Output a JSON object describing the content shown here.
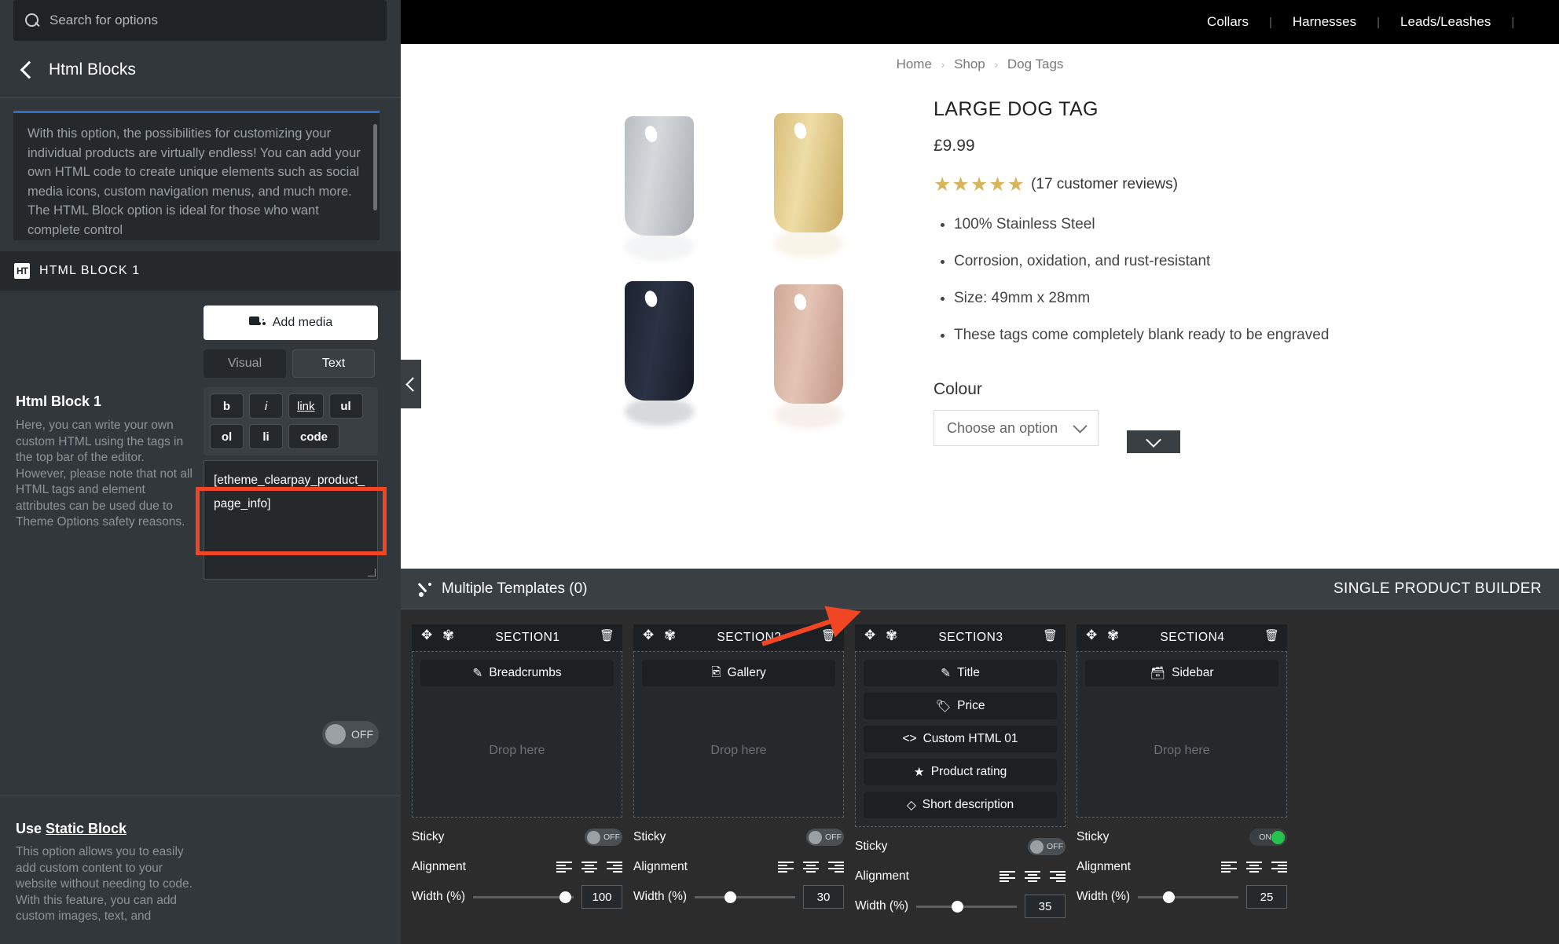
{
  "left_panel": {
    "search": {
      "placeholder": "Search for options",
      "icon": "search-icon"
    },
    "back_icon": "chevron-left-icon",
    "title": "Html Blocks",
    "info_text": "With this option, the possibilities for customizing your individual products are virtually endless! You can add your own HTML code to create unique elements such as social media icons, custom navigation menus, and much more. The HTML Block option is ideal for those who want complete control",
    "block_header": {
      "icon": "html-block-icon",
      "label": "HTML BLOCK 1"
    },
    "field": {
      "title": "Html Block 1",
      "description": "Here, you can write your own custom HTML using the tags in the top bar of the editor. However, please note that not all HTML tags and element attributes can be used due to Theme Options safety reasons."
    },
    "editor": {
      "add_media_label": "Add media",
      "add_media_icon": "media-icon",
      "tabs": [
        "Visual",
        "Text"
      ],
      "active_tab": "Text",
      "quicktags": [
        "b",
        "i",
        "link",
        "ul",
        "ol",
        "li",
        "code"
      ],
      "code_value": "[etheme_clearpay_product_page_info]",
      "highlight_color": "#f04623"
    },
    "static_block": {
      "title_prefix": "Use ",
      "title_link": "Static Block",
      "description": "This option allows you to easily add custom content to your website without needing to code. With this feature, you can add custom images, text, and"
    },
    "bottom_toggle": {
      "state": "OFF"
    }
  },
  "preview": {
    "nav_items": [
      "Collars",
      "Harnesses",
      "Leads/Leashes"
    ],
    "breadcrumb": [
      "Home",
      "Shop",
      "Dog Tags"
    ],
    "product": {
      "title": "LARGE DOG TAG",
      "price": "£9.99",
      "stars": "★★★★★",
      "reviews": "(17 customer reviews)",
      "features": [
        "100% Stainless Steel",
        "Corrosion, oxidation, and rust-resistant",
        "Size: 49mm x 28mm",
        "These tags come completely blank ready to be engraved"
      ],
      "attribute_label": "Colour",
      "attribute_placeholder": "Choose an option",
      "select_icon": "chevron-down-icon"
    },
    "collapse_icon": "chevron-left-icon",
    "scroll_icon": "chevron-down-icon"
  },
  "builder": {
    "templates_label": "Multiple Templates (0)",
    "templates_icon": "templates-icon",
    "builder_mode_label": "SINGLE PRODUCT BUILDER",
    "option_labels": {
      "sticky": "Sticky",
      "alignment": "Alignment",
      "width": "Width (%)"
    },
    "icons": {
      "move": "move-icon",
      "gear": "gear-icon",
      "trash": "trash-icon"
    },
    "sections": [
      {
        "name": "SECTION1",
        "elements": [
          {
            "label": "Breadcrumbs",
            "icon": "breadcrumbs-icon"
          }
        ],
        "drop_placeholder": "Drop here",
        "sticky": "OFF",
        "width": "100"
      },
      {
        "name": "SECTION2",
        "elements": [
          {
            "label": "Gallery",
            "icon": "gallery-icon"
          }
        ],
        "drop_placeholder": "Drop here",
        "sticky": "OFF",
        "width": "30"
      },
      {
        "name": "SECTION3",
        "elements": [
          {
            "label": "Title",
            "icon": "title-icon"
          },
          {
            "label": "Price",
            "icon": "price-tag-icon"
          },
          {
            "label": "Custom HTML 01",
            "icon": "code-icon"
          },
          {
            "label": "Product rating",
            "icon": "star-icon"
          },
          {
            "label": "Short description",
            "icon": "description-icon"
          }
        ],
        "drop_placeholder": "",
        "sticky": "OFF",
        "width": "35"
      },
      {
        "name": "SECTION4",
        "elements": [
          {
            "label": "Sidebar",
            "icon": "sidebar-icon"
          }
        ],
        "drop_placeholder": "Drop here",
        "sticky": "ON",
        "width": "25"
      }
    ]
  }
}
